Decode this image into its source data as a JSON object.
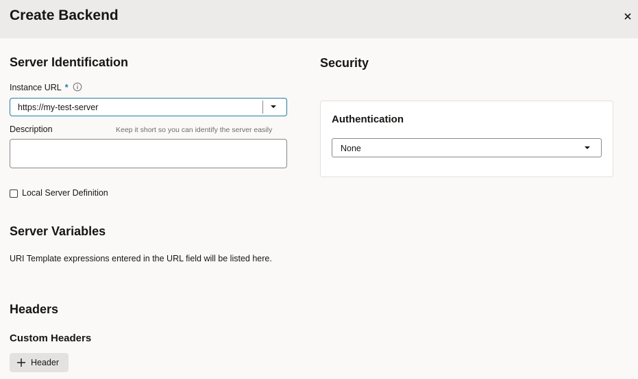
{
  "dialog": {
    "title": "Create Backend",
    "close_icon": "close-icon"
  },
  "server_identification": {
    "title": "Server Identification",
    "instance_url": {
      "label": "Instance URL",
      "required_mark": "*",
      "value": "https://my-test-server",
      "info_icon": "info-icon",
      "dropdown_icon": "caret-down-icon"
    },
    "description": {
      "label": "Description",
      "hint": "Keep it short so you can identify the server easily",
      "value": ""
    },
    "local_server": {
      "label": "Local Server Definition",
      "checked": false
    }
  },
  "server_variables": {
    "title": "Server Variables",
    "text": "URI Template expressions entered in the URL field will be listed here."
  },
  "headers": {
    "title": "Headers",
    "custom_headers_title": "Custom Headers",
    "add_button_label": "Header",
    "add_icon": "plus-icon"
  },
  "security": {
    "title": "Security",
    "authentication": {
      "title": "Authentication",
      "value": "None",
      "dropdown_icon": "caret-down-icon"
    }
  },
  "colors": {
    "header_bg": "#edebe9",
    "page_bg": "#faf9f8",
    "accent": "#227e9e"
  }
}
